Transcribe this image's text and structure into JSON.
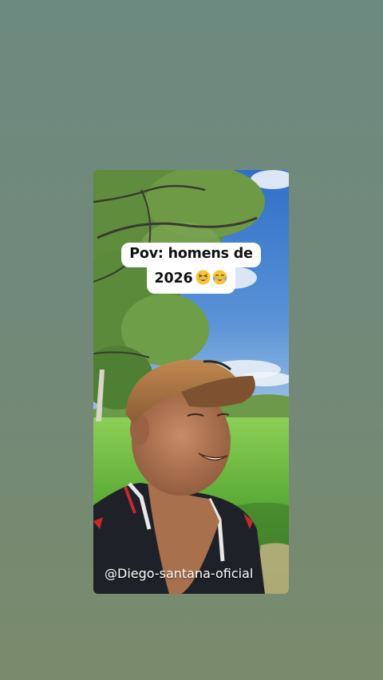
{
  "story": {
    "caption_line1": "Pov: homens de",
    "caption_line2": "2026",
    "caption_emojis": [
      "grinning-squinting-face-emoji",
      "face-with-tears-of-joy-emoji"
    ],
    "handle": "@Diego-santana-oficial"
  },
  "colors": {
    "background_top": "#6d8a80",
    "background_bottom": "#7a8a6c",
    "sky": "#4f87c9",
    "grass": "#5fae3a",
    "cap": "#b07a45",
    "caption_bg": "#ffffff",
    "caption_text": "#111111"
  }
}
